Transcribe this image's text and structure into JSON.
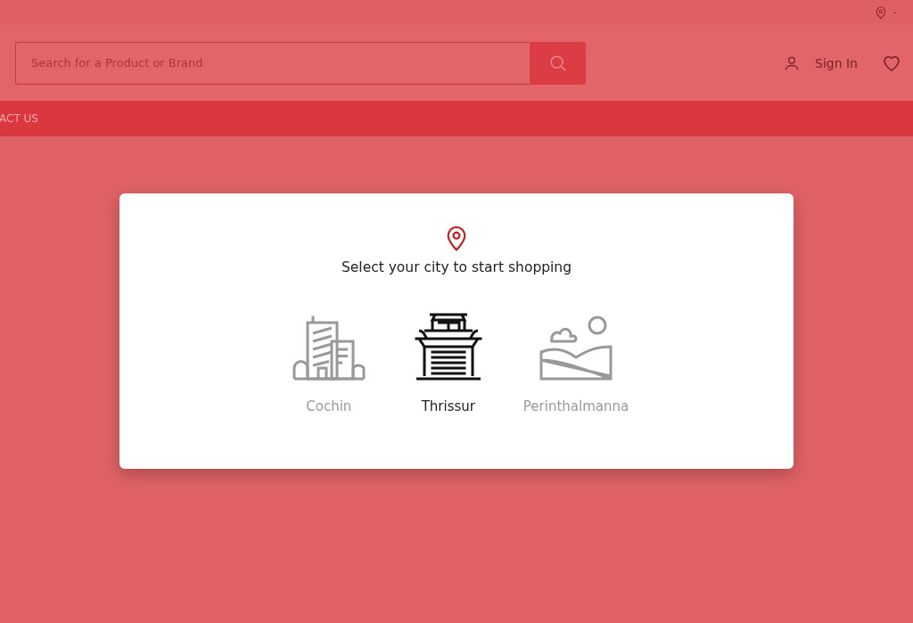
{
  "top_bar": {
    "location": "-"
  },
  "header": {
    "search": {
      "placeholder": "Search for a Product or Brand"
    },
    "sign_in": "Sign In"
  },
  "nav": {
    "items": [
      "ACT US"
    ]
  },
  "city_dialog": {
    "title": "Select your city to start shopping",
    "cities": [
      {
        "name": "Cochin",
        "kind": "building",
        "selected": false
      },
      {
        "name": "Thrissur",
        "kind": "temple",
        "selected": true
      },
      {
        "name": "Perinthalmanna",
        "kind": "landscape",
        "selected": false
      }
    ]
  }
}
